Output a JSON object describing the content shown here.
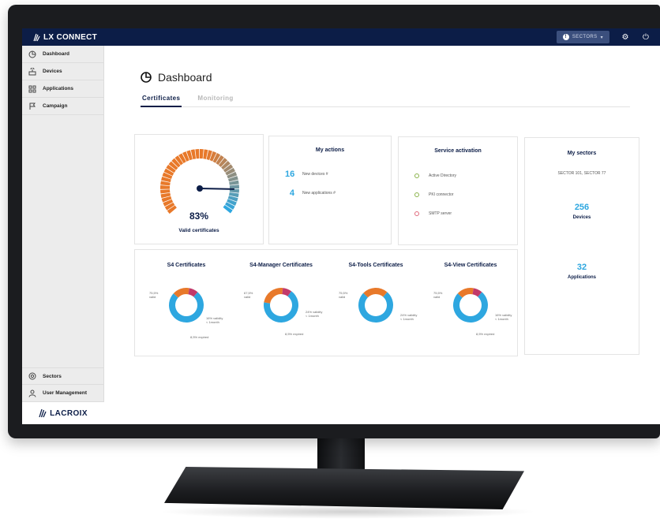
{
  "app": {
    "brand": "LX CONNECT",
    "sector_button": "SECTORS",
    "footer_logo": "LACROIX",
    "colors": {
      "navy": "#0c1d47",
      "accent": "#2ea7e0",
      "orange": "#e8792a",
      "magenta": "#c23a6a"
    }
  },
  "sidebar": {
    "items": [
      {
        "label": "Dashboard",
        "icon": "dashboard-icon"
      },
      {
        "label": "Devices",
        "icon": "devices-icon"
      },
      {
        "label": "Applications",
        "icon": "applications-icon"
      },
      {
        "label": "Campaign",
        "icon": "flag-icon"
      }
    ],
    "bottom": [
      {
        "label": "Sectors",
        "icon": "sectors-icon"
      },
      {
        "label": "User Management",
        "icon": "user-icon"
      }
    ]
  },
  "page": {
    "title": "Dashboard",
    "tabs": [
      {
        "label": "Certificates",
        "active": true
      },
      {
        "label": "Monitoring",
        "active": false
      }
    ]
  },
  "gauge": {
    "value_text": "83%",
    "value": 0.83,
    "label": "Valid certificates"
  },
  "actions": {
    "title": "My actions",
    "rows": [
      {
        "count": "16",
        "text": "New devices #"
      },
      {
        "count": "4",
        "text": "New applications #"
      }
    ]
  },
  "services": {
    "title": "Service activation",
    "rows": [
      {
        "name": "Active Directory",
        "status": "ok"
      },
      {
        "name": "PKI connector",
        "status": "ok"
      },
      {
        "name": "SMTP server",
        "status": "off"
      }
    ]
  },
  "sectors": {
    "title": "My sectors",
    "list_text": "SECTOR 101, SECTOR 77",
    "devices_count": "256",
    "devices_label": "Devices",
    "apps_count": "32",
    "apps_label": "Applications"
  },
  "certificates": [
    {
      "title": "S4 Certificates",
      "left": "75,5%\nvalid",
      "right": "16% validity\n< 1month",
      "bottom": "8,5% expired"
    },
    {
      "title": "S4-Manager Certificates",
      "left": "67,5%\nvalid",
      "right": "24% validity\n< 1month",
      "bottom": "8,5% expired"
    },
    {
      "title": "S4-Tools Certificates",
      "left": "75,5%\nvalid",
      "right": "24% validity\n< 1month",
      "bottom": ""
    },
    {
      "title": "S4-View Certificates",
      "left": "75,5%\nvalid",
      "right": "16% validity\n< 1month",
      "bottom": "8,5% expired"
    }
  ],
  "chart_data": [
    {
      "type": "pie",
      "title": "S4 Certificates",
      "categories": [
        "valid",
        "validity < 1month",
        "expired"
      ],
      "values": [
        75.5,
        16,
        8.5
      ]
    },
    {
      "type": "pie",
      "title": "S4-Manager Certificates",
      "categories": [
        "valid",
        "validity < 1month",
        "expired"
      ],
      "values": [
        67.5,
        24,
        8.5
      ]
    },
    {
      "type": "pie",
      "title": "S4-Tools Certificates",
      "categories": [
        "valid",
        "validity < 1month"
      ],
      "values": [
        75.5,
        24
      ]
    },
    {
      "type": "pie",
      "title": "S4-View Certificates",
      "categories": [
        "valid",
        "validity < 1month",
        "expired"
      ],
      "values": [
        75.5,
        16,
        8.5
      ]
    }
  ]
}
